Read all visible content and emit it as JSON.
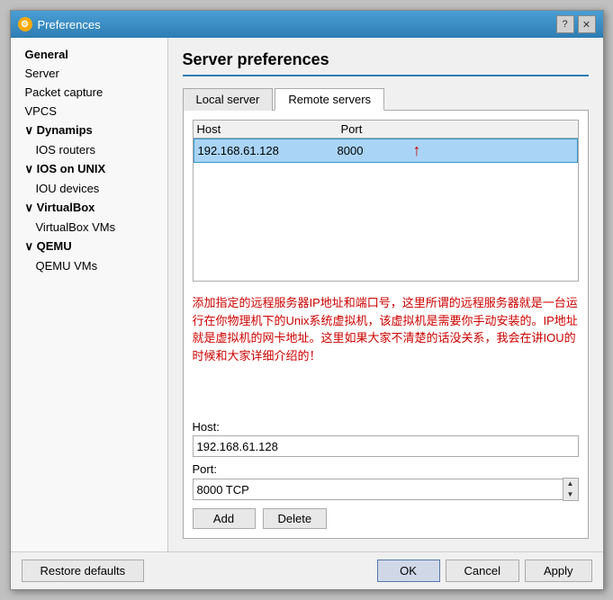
{
  "window": {
    "title": "Preferences",
    "icon": "⚙"
  },
  "titlebar": {
    "help_btn": "?",
    "close_btn": "✕"
  },
  "sidebar": {
    "items": [
      {
        "id": "general",
        "label": "General",
        "bold": true,
        "indented": false
      },
      {
        "id": "server",
        "label": "Server",
        "bold": false,
        "indented": false
      },
      {
        "id": "packet-capture",
        "label": "Packet capture",
        "bold": false,
        "indented": false
      },
      {
        "id": "vpcs",
        "label": "VPCS",
        "bold": false,
        "indented": false
      },
      {
        "id": "dynamips",
        "label": "Dynamips",
        "bold": true,
        "indented": false
      },
      {
        "id": "ios-routers",
        "label": "IOS routers",
        "bold": false,
        "indented": true
      },
      {
        "id": "ios-on-unix",
        "label": "IOS on UNIX",
        "bold": true,
        "indented": false
      },
      {
        "id": "iou-devices",
        "label": "IOU devices",
        "bold": false,
        "indented": true
      },
      {
        "id": "virtualbox",
        "label": "VirtualBox",
        "bold": true,
        "indented": false
      },
      {
        "id": "virtualbox-vms",
        "label": "VirtualBox VMs",
        "bold": false,
        "indented": true
      },
      {
        "id": "qemu",
        "label": "QEMU",
        "bold": true,
        "indented": false
      },
      {
        "id": "qemu-vms",
        "label": "QEMU VMs",
        "bold": false,
        "indented": true
      }
    ]
  },
  "main": {
    "title": "Server preferences",
    "tabs": [
      {
        "id": "local-server",
        "label": "Local server"
      },
      {
        "id": "remote-servers",
        "label": "Remote servers"
      }
    ],
    "active_tab": "remote-servers",
    "table": {
      "columns": [
        "Host",
        "Port"
      ],
      "rows": [
        {
          "host": "192.168.61.128",
          "port": "8000"
        }
      ]
    },
    "description": "添加指定的远程服务器IP地址和端口号，这里所谓的远程服务器就是一台运行在你物理机下的Unix系统虚拟机，该虚拟机是需要你手动安装的。IP地址就是虚拟机的网卡地址。这里如果大家不清楚的话没关系，我会在讲IOU的时候和大家详细介绍的！",
    "form": {
      "host_label": "Host:",
      "host_value": "192.168.61.128",
      "port_label": "Port:",
      "port_value": "8000 TCP"
    },
    "buttons": {
      "add": "Add",
      "delete": "Delete"
    }
  },
  "footer": {
    "restore_defaults": "Restore defaults",
    "ok": "OK",
    "cancel": "Cancel",
    "apply": "Apply"
  }
}
